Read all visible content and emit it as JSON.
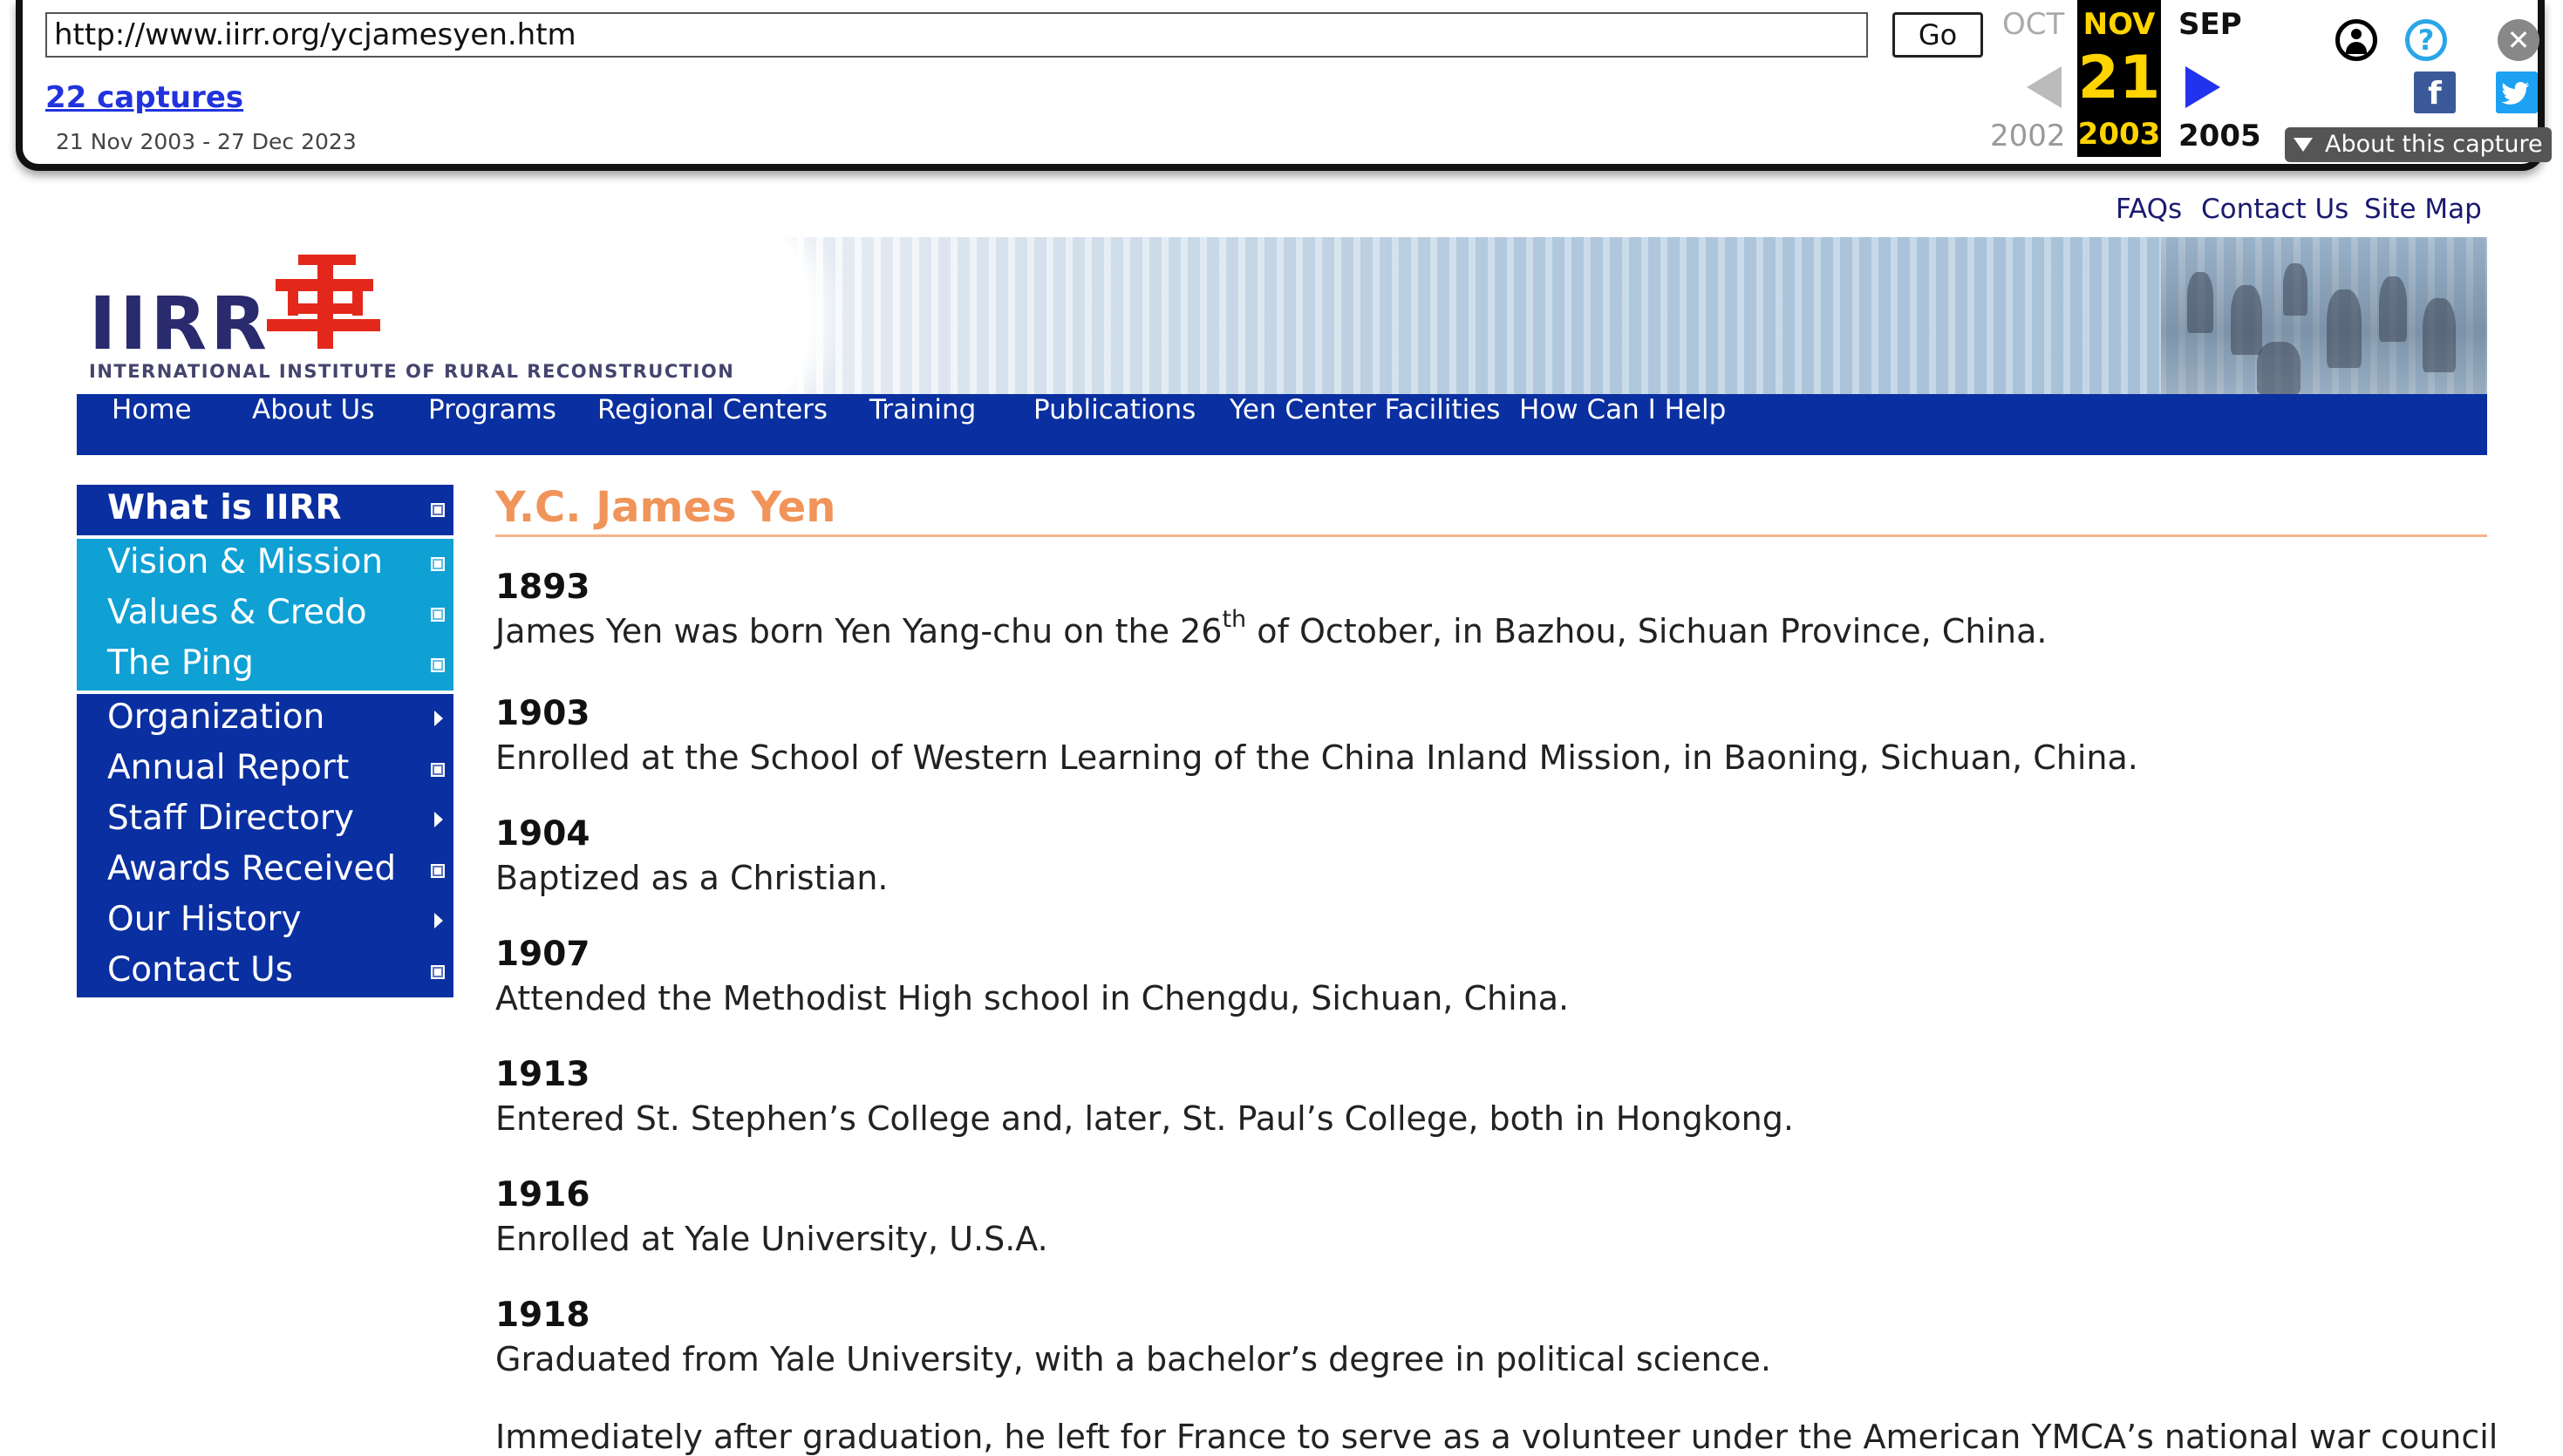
{
  "wayback": {
    "url_value": "http://www.iirr.org/ycjamesyen.htm",
    "go_label": "Go",
    "captures_label": "22 captures",
    "date_range": "21 Nov 2003 - 27 Dec 2023",
    "prev_month": "OCT",
    "current_month": "NOV",
    "next_month": "SEP",
    "current_day": "21",
    "prev_year": "2002",
    "current_year": "2003",
    "next_year": "2005",
    "help_glyph": "?",
    "close_glyph": "✕",
    "facebook_glyph": "f",
    "twitter_glyph": "🐦",
    "about_label": "About this capture"
  },
  "top_links": {
    "faqs": "FAQs",
    "contact": "Contact Us",
    "sitemap": "Site Map"
  },
  "banner": {
    "logo_text": "IIRR",
    "tagline": "INTERNATIONAL INSTITUTE OF RURAL RECONSTRUCTION",
    "logo_color": "#e3281b"
  },
  "nav": {
    "items": [
      {
        "label": "Home"
      },
      {
        "label": "About Us"
      },
      {
        "label": "Programs"
      },
      {
        "label": "Regional Centers"
      },
      {
        "label": "Training"
      },
      {
        "label": "Publications"
      },
      {
        "label": "Yen Center Facilities"
      },
      {
        "label": "How Can I Help"
      }
    ],
    "bg_color": "#0a2fa0"
  },
  "sidebar": {
    "items": [
      {
        "label": "What is IIRR",
        "style": "head",
        "marker": "square"
      },
      {
        "label": "Vision & Mission",
        "style": "sub",
        "marker": "square"
      },
      {
        "label": "Values & Credo",
        "style": "sub",
        "marker": "square"
      },
      {
        "label": "The Ping",
        "style": "sub",
        "marker": "square"
      },
      {
        "label": "Organization",
        "style": "main",
        "marker": "arrow"
      },
      {
        "label": "Annual Report",
        "style": "main",
        "marker": "square"
      },
      {
        "label": "Staff Directory",
        "style": "main",
        "marker": "arrow"
      },
      {
        "label": "Awards Received",
        "style": "main",
        "marker": "square"
      },
      {
        "label": "Our History",
        "style": "main",
        "marker": "arrow"
      },
      {
        "label": "Contact Us",
        "style": "main",
        "marker": "square"
      }
    ],
    "colors": {
      "head": "#0a2fa0",
      "sub": "#0fa0d4",
      "main": "#0a2fa0"
    }
  },
  "content": {
    "title": "Y.C. James Yen",
    "title_color": "#f0945a",
    "entries": [
      {
        "year": "1893",
        "text_before": "James Yen was born Yen Yang-chu on the 26",
        "sup": "th",
        "text_after": " of October, in Bazhou, Sichuan Province, China."
      },
      {
        "year": "1903",
        "text": "Enrolled at the School of Western Learning of the China Inland Mission, in Baoning, Sichuan, China."
      },
      {
        "year": "1904",
        "text": "Baptized as a Christian."
      },
      {
        "year": "1907",
        "text": "Attended the Methodist High school in Chengdu, Sichuan, China."
      },
      {
        "year": "1913",
        "text": "Entered St. Stephen’s College and, later, St. Paul’s College, both in Hongkong."
      },
      {
        "year": "1916",
        "text": "Enrolled at Yale University, U.S.A."
      },
      {
        "year": "1918",
        "text": "Graduated from Yale University, with a bachelor’s degree in political science."
      }
    ],
    "continuation": "Immediately after graduation, he left for France to serve as a volunteer under the American YMCA’s national war council. His job"
  }
}
